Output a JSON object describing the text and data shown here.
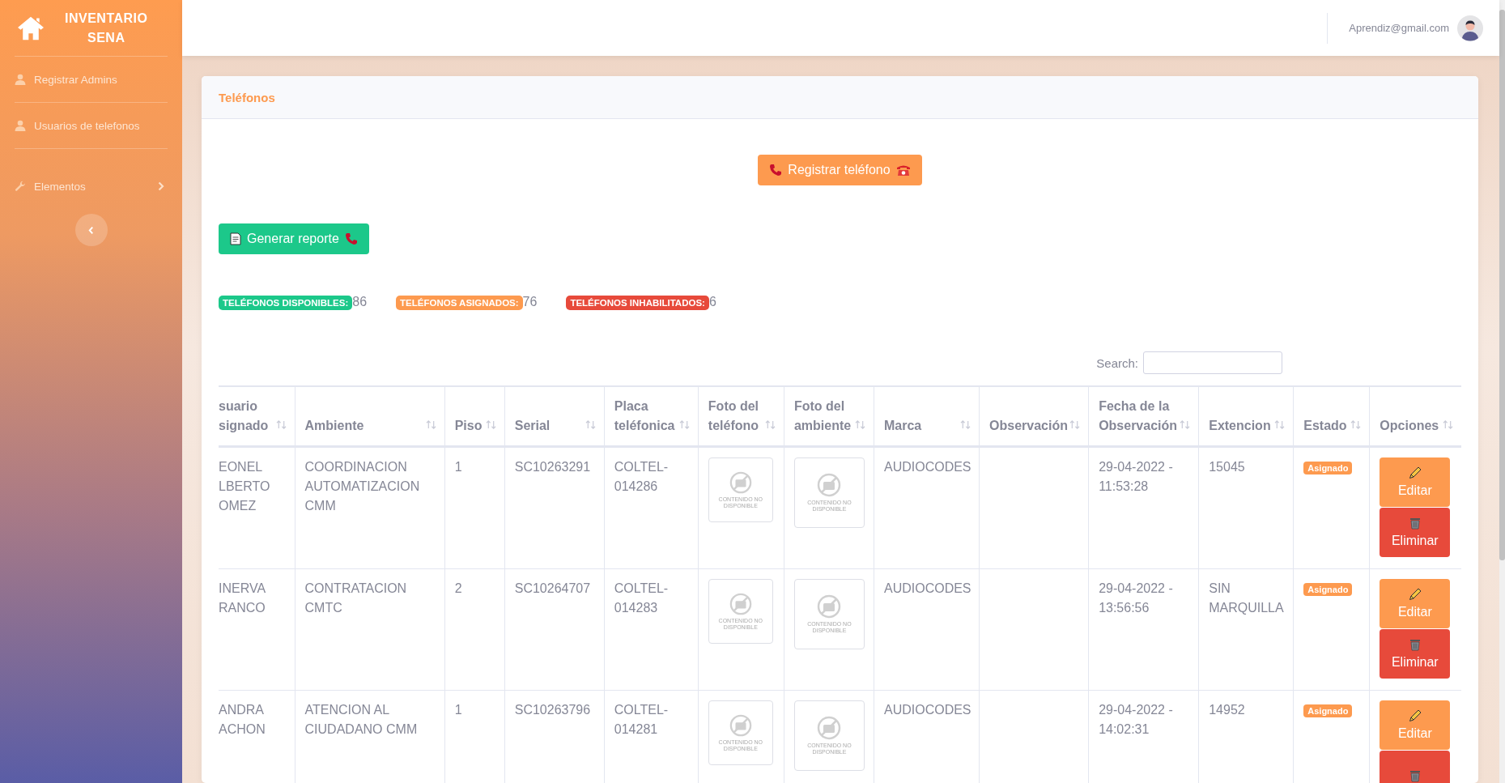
{
  "sidebar": {
    "brand": [
      "INVENTARIO",
      "SENA"
    ],
    "items": [
      {
        "label": "Registrar Admins",
        "kind": "user"
      },
      {
        "label": "Usuarios de telefonos",
        "kind": "user"
      },
      {
        "label": "Elementos",
        "kind": "group"
      }
    ]
  },
  "topbar": {
    "user_email": "Aprendiz@gmail.com"
  },
  "card": {
    "title": "Teléfonos",
    "register_button": "Registrar teléfono",
    "report_button": "Generar reporte",
    "stats": [
      {
        "label": "TELÉFONOS DISPONIBLES:",
        "count": "86",
        "color": "#1cc88a"
      },
      {
        "label": "TELÉFONOS ASIGNADOS:",
        "count": "76",
        "color": "#fd9a4f"
      },
      {
        "label": "TELÉFONOS INHABILITADOS:",
        "count": "6",
        "color": "#e74a3b"
      }
    ],
    "search": {
      "label": "Search:"
    }
  },
  "table": {
    "columns": [
      [
        "suario",
        "signado"
      ],
      [
        "Ambiente"
      ],
      [
        "Piso"
      ],
      [
        "Serial"
      ],
      [
        "Placa",
        "teléfonica"
      ],
      [
        "Foto del",
        "teléfono"
      ],
      [
        "Foto del",
        "ambiente"
      ],
      [
        "Marca"
      ],
      [
        "Observación"
      ],
      [
        "Fecha de la",
        "Observación"
      ],
      [
        "Extencion"
      ],
      [
        "Estado"
      ],
      [
        "Opciones"
      ]
    ],
    "rows": [
      {
        "user": [
          "EONEL",
          "LBERTO",
          "OMEZ"
        ],
        "ambiente": "COORDINACION AUTOMATIZACION CMM",
        "piso": "1",
        "serial": "SC10263291",
        "placa": "COLTEL-014286",
        "phone_photo": "CONTENIDO NO DISPONIBLE",
        "room_photo": "CONTENIDO NO DISPONIBLE",
        "marca": "AUDIOCODES",
        "fecha": "29-04-2022 - 11:53:28",
        "extension": "15045",
        "estado": "Asignado",
        "edit_label": "Editar",
        "delete_label": "Eliminar"
      },
      {
        "user": [
          "INERVA",
          "RANCO"
        ],
        "ambiente": "CONTRATACION CMTC",
        "piso": "2",
        "serial": "SC10264707",
        "placa": "COLTEL-014283",
        "phone_photo": "CONTENIDO NO DISPONIBLE",
        "room_photo": "CONTENIDO NO DISPONIBLE",
        "marca": "AUDIOCODES",
        "fecha": "29-04-2022 - 13:56:56",
        "extension": "SIN MARQUILLA",
        "estado": "Asignado",
        "edit_label": "Editar",
        "delete_label": "Eliminar"
      },
      {
        "user": [
          "ANDRA",
          "ACHON"
        ],
        "ambiente": "ATENCION AL CIUDADANO CMM",
        "piso": "1",
        "serial": "SC10263796",
        "placa": "COLTEL-014281",
        "phone_photo": "CONTENIDO NO DISPONIBLE",
        "room_photo": "CONTENIDO NO DISPONIBLE",
        "marca": "AUDIOCODES",
        "fecha": "29-04-2022 - 14:02:31",
        "extension": "14952",
        "estado": "Asignado",
        "edit_label": "Editar"
      }
    ]
  }
}
